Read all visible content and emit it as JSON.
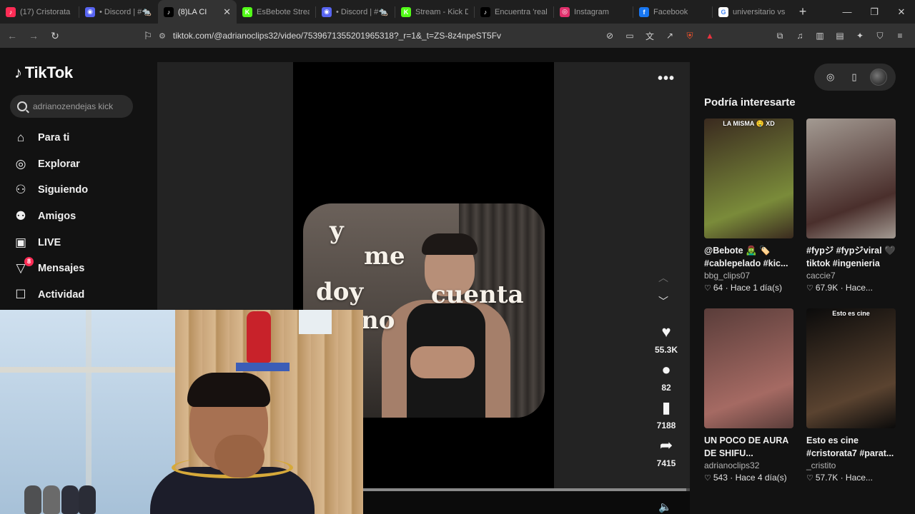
{
  "browser": {
    "tabs": [
      {
        "title": "(17) Cristorata",
        "color": "#fe2c55",
        "glyph": "♪",
        "active": false
      },
      {
        "title": "• Discord | #🐀",
        "color": "#5865f2",
        "glyph": "◉",
        "active": false
      },
      {
        "title": "(8)LA CI",
        "color": "#000000",
        "glyph": "♪",
        "active": true
      },
      {
        "title": "EsBebote Strea",
        "color": "#53fc18",
        "glyph": "K",
        "active": false
      },
      {
        "title": "• Discord | #🐀",
        "color": "#5865f2",
        "glyph": "◉",
        "active": false
      },
      {
        "title": "Stream - Kick D",
        "color": "#53fc18",
        "glyph": "K",
        "active": false
      },
      {
        "title": "Encuentra 'real",
        "color": "#000000",
        "glyph": "♪",
        "active": false
      },
      {
        "title": "Instagram",
        "color": "#e1306c",
        "glyph": "◎",
        "active": false
      },
      {
        "title": "Facebook",
        "color": "#1877f2",
        "glyph": "f",
        "active": false
      },
      {
        "title": "universitario vs",
        "color": "#ffffff",
        "glyph": "G",
        "active": false
      }
    ],
    "url": "tiktok.com/@adrianoclips32/video/7539671355201965318?_r=1&_t=ZS-8z4npeST5Fv"
  },
  "sidebar": {
    "logo": "TikTok",
    "search_value": "adrianozendejas kick",
    "items": [
      {
        "label": "Para ti",
        "icon": "⌂",
        "name": "home-icon"
      },
      {
        "label": "Explorar",
        "icon": "◎",
        "name": "compass-icon"
      },
      {
        "label": "Siguiendo",
        "icon": "⚇",
        "name": "following-icon"
      },
      {
        "label": "Amigos",
        "icon": "⚉",
        "name": "friends-icon"
      },
      {
        "label": "LIVE",
        "icon": "▣",
        "name": "live-icon"
      },
      {
        "label": "Mensajes",
        "icon": "▽",
        "name": "messages-icon",
        "badge": "8"
      },
      {
        "label": "Actividad",
        "icon": "☐",
        "name": "activity-icon"
      }
    ]
  },
  "video": {
    "caption_words": [
      "y",
      "me",
      "doy",
      "cuenta",
      "no"
    ],
    "progress": 0.99,
    "likes": "55.3K",
    "comments": "82",
    "saves": "7188",
    "shares": "7415"
  },
  "recommendations": {
    "title": "Podría interesarte",
    "cards": [
      {
        "thumb_text": "LA MISMA 🤤 XD",
        "title": "@Bebote 🧟‍♂️ 🏷️ #cablepelado #kic...",
        "user": "bbg_clips07",
        "likes": "64",
        "time": "Hace 1 día(s)",
        "bg": "#3a2a1f",
        "accent": "#7a8b3a"
      },
      {
        "thumb_text": "",
        "title": "#fypジ #fypジviral 🖤 tiktok #ingenieria",
        "user": "caccie7",
        "likes": "67.9K",
        "time": "Hace...",
        "bg": "#a39a92",
        "accent": "#4a2f2c"
      },
      {
        "thumb_text": "",
        "title": "UN POCO DE AURA DE SHIFU...",
        "user": "adrianoclips32",
        "likes": "543",
        "time": "Hace 4 día(s)",
        "bg": "#5a3d3a",
        "accent": "#a56a63"
      },
      {
        "thumb_text": "Esto es cine",
        "title": "Esto es cine #cristorata7 #parat...",
        "user": "_cristito",
        "likes": "57.7K",
        "time": "Hace...",
        "bg": "#0b0b0b",
        "accent": "#5a4330"
      }
    ]
  }
}
